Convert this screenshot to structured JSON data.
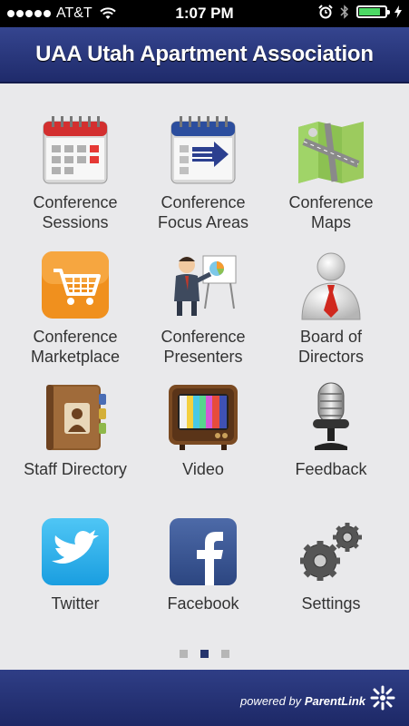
{
  "status_bar": {
    "carrier": "AT&T",
    "time": "1:07 PM",
    "icons": [
      "signal-dots",
      "wifi-icon",
      "alarm-icon",
      "bluetooth-icon",
      "battery-icon",
      "charging-icon"
    ],
    "battery_level": 0.9
  },
  "header": {
    "title": "UAA Utah Apartment Association"
  },
  "grid": {
    "items": [
      {
        "line1": "Conference",
        "line2": "Sessions",
        "icon": "calendar-icon"
      },
      {
        "line1": "Conference",
        "line2": "Focus Areas",
        "icon": "calendar-arrows-icon"
      },
      {
        "line1": "Conference",
        "line2": "Maps",
        "icon": "map-icon"
      },
      {
        "line1": "Conference",
        "line2": "Marketplace",
        "icon": "shopping-cart-icon"
      },
      {
        "line1": "Conference",
        "line2": "Presenters",
        "icon": "presenter-icon"
      },
      {
        "line1": "Board of",
        "line2": "Directors",
        "icon": "person-tie-icon"
      },
      {
        "line1": "Staff Directory",
        "line2": "",
        "icon": "address-book-icon"
      },
      {
        "line1": "Video",
        "line2": "",
        "icon": "tv-icon"
      },
      {
        "line1": "Feedback",
        "line2": "",
        "icon": "microphone-icon"
      },
      {
        "line1": "Twitter",
        "line2": "",
        "icon": "twitter-icon"
      },
      {
        "line1": "Facebook",
        "line2": "",
        "icon": "facebook-icon"
      },
      {
        "line1": "Settings",
        "line2": "",
        "icon": "gears-icon"
      }
    ]
  },
  "pager": {
    "pages": 3,
    "current": 2
  },
  "footer": {
    "powered_by": "powered by",
    "brand": "ParentLink"
  },
  "colors": {
    "header": "#2a3a7f",
    "footer": "#25326f",
    "background": "#e9e9eb",
    "active_dot": "#25346d"
  }
}
